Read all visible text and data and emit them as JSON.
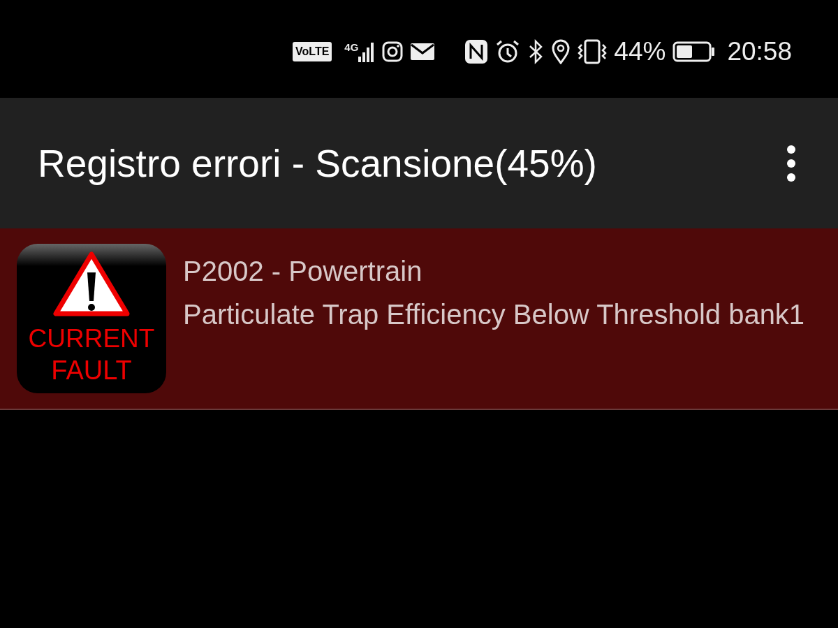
{
  "status_bar": {
    "network_badge": "VoLTE",
    "network_type": "4G",
    "battery": "44%",
    "time": "20:58"
  },
  "app_bar": {
    "title": "Registro errori - Scansione(45%)"
  },
  "faults": [
    {
      "kind": "current",
      "badge_lines": [
        "CURRENT",
        "FAULT"
      ],
      "code": "P2002 - Powertrain",
      "description": "Particulate Trap Efficiency Below Threshold bank1"
    }
  ]
}
